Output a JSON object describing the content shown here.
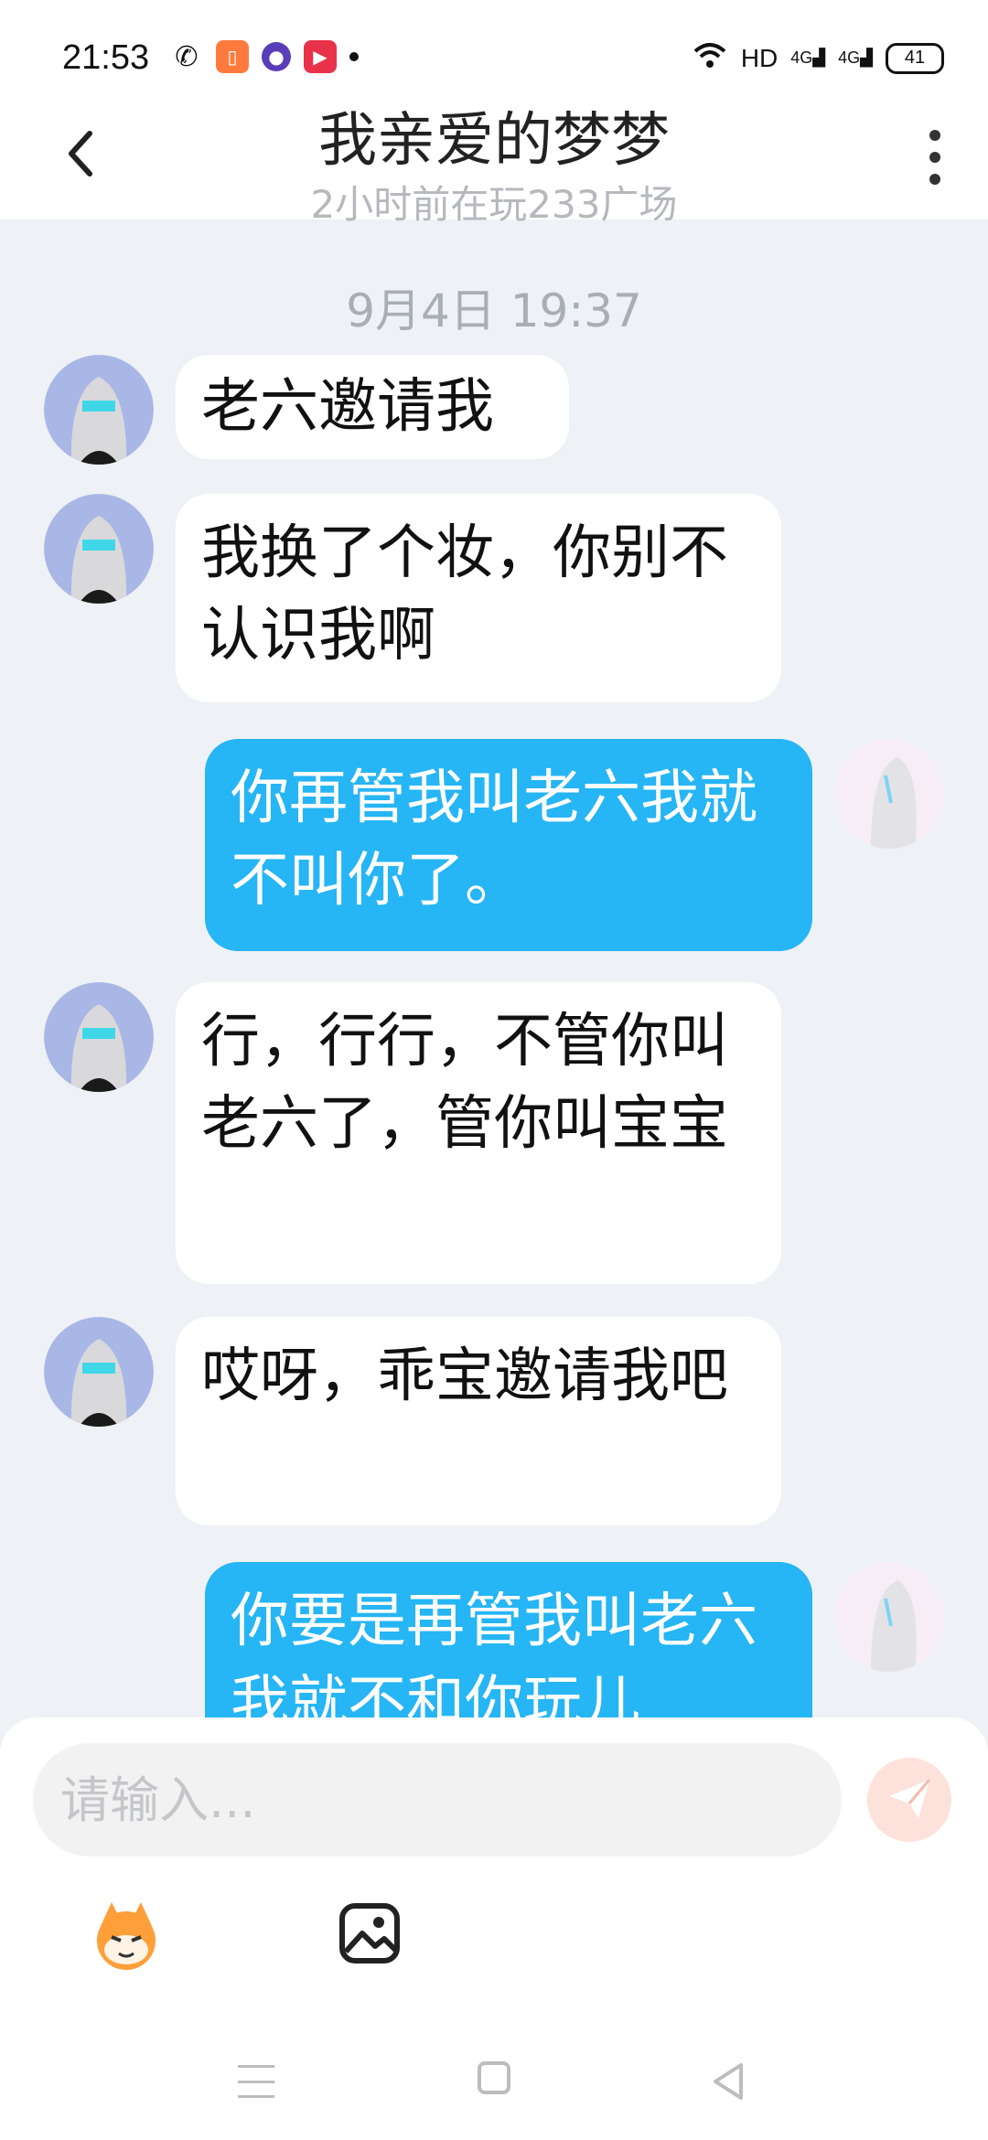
{
  "status_bar": {
    "time": "21:53",
    "network": "HD",
    "signal1": "4G",
    "signal2": "4G",
    "battery": "41"
  },
  "header": {
    "title": "我亲爱的梦梦",
    "subtitle": "2小时前在玩233广场"
  },
  "chat": {
    "date": "9月4日 19:37",
    "messages": [
      {
        "side": "in",
        "text": "老六邀请我"
      },
      {
        "side": "in",
        "text": "我换了个妆，你别不认识我啊"
      },
      {
        "side": "out",
        "text": "你再管我叫老六我就不叫你了。"
      },
      {
        "side": "in",
        "text": "行，行行，不管你叫老六了，管你叫宝宝"
      },
      {
        "side": "in",
        "text": "哎呀，乖宝邀请我吧"
      },
      {
        "side": "out",
        "text": "你要是再管我叫老六我就不和你玩儿"
      }
    ]
  },
  "composer": {
    "placeholder": "请输入..."
  },
  "colors": {
    "accent_blue": "#26b5f5",
    "chat_bg": "#eef1f5",
    "send_disabled": "#fde2dc"
  }
}
